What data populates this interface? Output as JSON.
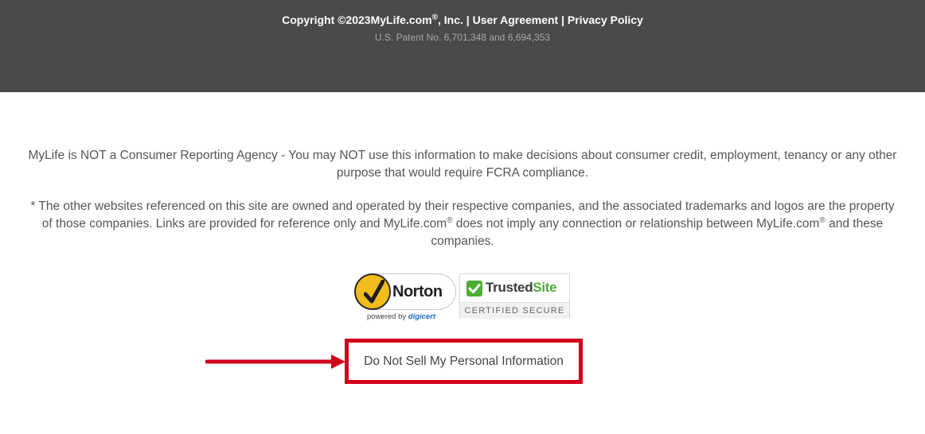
{
  "footer": {
    "copyright_prefix": "Copyright ©2023MyLife.com",
    "copyright_reg": "®",
    "copyright_suffix": ", Inc.",
    "separator": "|",
    "user_agreement": "User Agreement",
    "privacy_policy": "Privacy Policy",
    "patent": "U.S. Patent No. 6,701,348 and 6,694,353"
  },
  "disclaimers": {
    "fcra": "MyLife is NOT a Consumer Reporting Agency - You may NOT use this information to make decisions about consumer credit, employment, tenancy or any other purpose that would require FCRA compliance.",
    "trademark_part1": "* The other websites referenced on this site are owned and operated by their respective companies, and the associated trademarks and logos are the property of those companies. Links are provided for reference only and MyLife.com",
    "trademark_reg1": "®",
    "trademark_part2": " does not imply any connection or relationship between MyLife.com",
    "trademark_reg2": "®",
    "trademark_part3": " and these companies."
  },
  "badges": {
    "norton": {
      "name": "Norton",
      "powered_by": "powered by",
      "digicert": "digicert"
    },
    "trustedsite": {
      "name_part1": "Trusted",
      "name_part2": "Site",
      "certified": "CERTIFIED SECURE"
    }
  },
  "do_not_sell": "Do Not Sell My Personal Information",
  "colors": {
    "footer_bg": "#4a4a4a",
    "highlight": "#d0021b",
    "norton_yellow": "#f2bd1b",
    "trusted_green": "#4cad33"
  },
  "icons": {
    "norton_check": "checkmark-icon",
    "trusted_check": "checkmark-icon",
    "annotation_arrow": "arrow-right-icon"
  }
}
